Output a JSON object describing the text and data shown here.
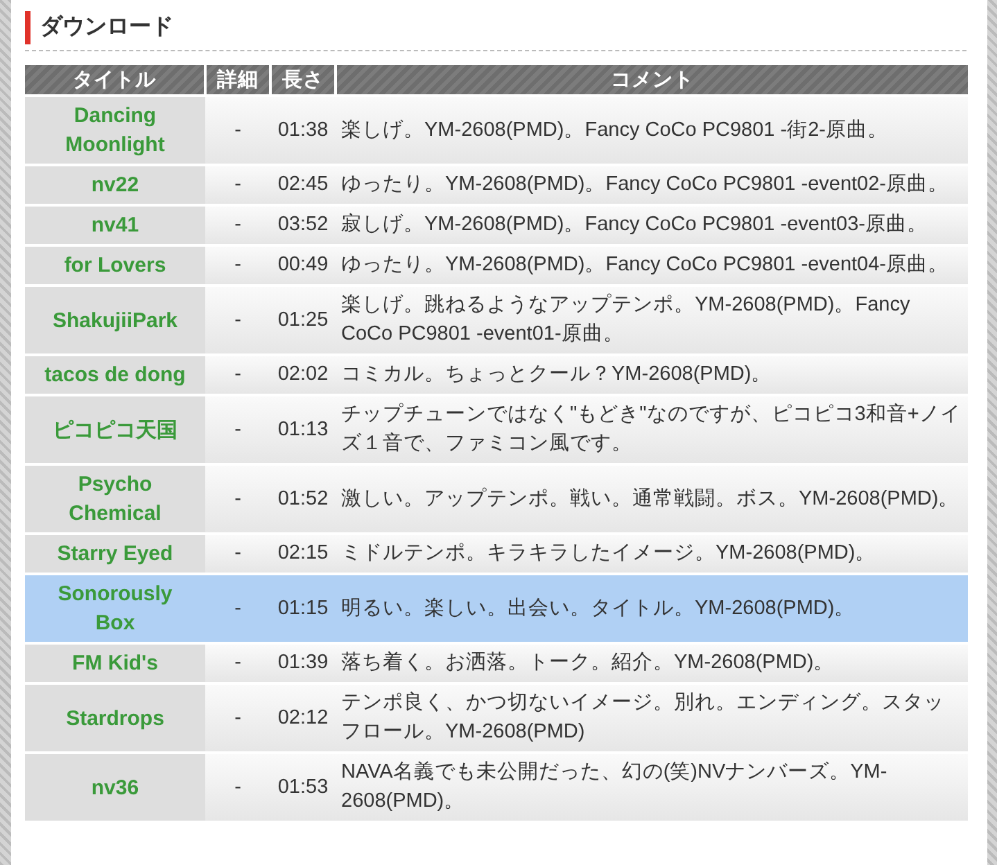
{
  "section_title": "ダウンロード",
  "table": {
    "columns": [
      "タイトル",
      "詳細",
      "長さ",
      "コメント"
    ],
    "rows": [
      {
        "title": "Dancing Moonlight",
        "detail": "-",
        "length": "01:38",
        "comment": "楽しげ。YM-2608(PMD)。Fancy CoCo PC9801 -街2-原曲。",
        "selected": false
      },
      {
        "title": "nv22",
        "detail": "-",
        "length": "02:45",
        "comment": "ゆったり。YM-2608(PMD)。Fancy CoCo PC9801 -event02-原曲。",
        "selected": false
      },
      {
        "title": "nv41",
        "detail": "-",
        "length": "03:52",
        "comment": "寂しげ。YM-2608(PMD)。Fancy CoCo PC9801 -event03-原曲。",
        "selected": false
      },
      {
        "title": "for Lovers",
        "detail": "-",
        "length": "00:49",
        "comment": "ゆったり。YM-2608(PMD)。Fancy CoCo PC9801 -event04-原曲。",
        "selected": false
      },
      {
        "title": "ShakujiiPark",
        "detail": "-",
        "length": "01:25",
        "comment": "楽しげ。跳ねるようなアップテンポ。YM-2608(PMD)。Fancy CoCo PC9801 -event01-原曲。",
        "selected": false
      },
      {
        "title": "tacos de dong",
        "detail": "-",
        "length": "02:02",
        "comment": "コミカル。ちょっとクール？YM-2608(PMD)。",
        "selected": false
      },
      {
        "title": "ピコピコ天国",
        "detail": "-",
        "length": "01:13",
        "comment": "チップチューンではなく\"もどき\"なのですが、ピコピコ3和音+ノイズ１音で、ファミコン風です。",
        "selected": false
      },
      {
        "title": "Psycho Chemical",
        "detail": "-",
        "length": "01:52",
        "comment": "激しい。アップテンポ。戦い。通常戦闘。ボス。YM-2608(PMD)。",
        "selected": false
      },
      {
        "title": "Starry Eyed",
        "detail": "-",
        "length": "02:15",
        "comment": "ミドルテンポ。キラキラしたイメージ。YM-2608(PMD)。",
        "selected": false
      },
      {
        "title": "Sonorously Box",
        "detail": "-",
        "length": "01:15",
        "comment": "明るい。楽しい。出会い。タイトル。YM-2608(PMD)。",
        "selected": true
      },
      {
        "title": "FM Kid's",
        "detail": "-",
        "length": "01:39",
        "comment": "落ち着く。お洒落。トーク。紹介。YM-2608(PMD)。",
        "selected": false
      },
      {
        "title": "Stardrops",
        "detail": "-",
        "length": "02:12",
        "comment": "テンポ良く、かつ切ないイメージ。別れ。エンディング。スタッフロール。YM-2608(PMD)",
        "selected": false
      },
      {
        "title": "nv36",
        "detail": "-",
        "length": "01:53",
        "comment": "NAVA名義でも未公開だった、幻の(笑)NVナンバーズ。YM-2608(PMD)。",
        "selected": false
      }
    ]
  }
}
